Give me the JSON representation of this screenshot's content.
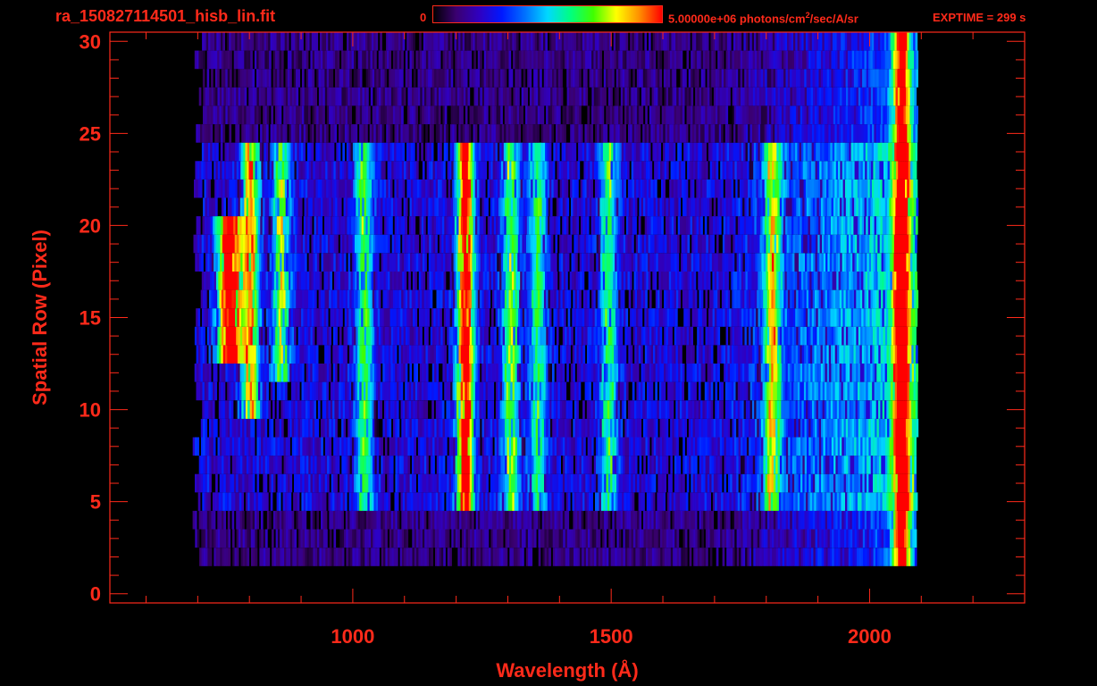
{
  "header": {
    "file_name": "ra_150827114501_hisb_lin.fit",
    "colorbar_min": "0",
    "colorbar_max_prefix": "5.00000e+06 photons/cm",
    "colorbar_max_exp": "2",
    "colorbar_max_suffix": "/sec/A/sr",
    "exptime": "EXPTIME = 299 s"
  },
  "colors": {
    "axis": "#ff2a1a",
    "background": "#000000",
    "colormap": [
      "#000000",
      "#3a0070",
      "#3000c0",
      "#0018ff",
      "#0070ff",
      "#00d8ff",
      "#00ff80",
      "#40ff00",
      "#ffff00",
      "#ff9000",
      "#ff0000"
    ]
  },
  "chart_data": {
    "type": "heatmap",
    "title": "",
    "xlabel": "Wavelength (Å)",
    "ylabel": "Spatial Row (Pixel)",
    "xlim": [
      530,
      2300
    ],
    "ylim": [
      -0.5,
      30.5
    ],
    "xticks": [
      1000,
      1500,
      2000
    ],
    "yticks": [
      0,
      5,
      10,
      15,
      20,
      25,
      30
    ],
    "x_minor_step": 100,
    "y_minor_step": 1,
    "value_range": [
      0,
      5000000
    ],
    "value_units": "photons/cm^2/sec/A/sr",
    "data_extent": {
      "wavelength": [
        700,
        2090
      ],
      "rows": [
        2,
        30
      ],
      "bright_slit_rows": [
        5,
        24
      ]
    },
    "features": [
      {
        "wavelength": 760,
        "rows": [
          13,
          20
        ],
        "peak": 1.0
      },
      {
        "wavelength": 800,
        "rows": [
          10,
          24
        ],
        "peak": 0.7
      },
      {
        "wavelength": 860,
        "rows": [
          12,
          24
        ],
        "peak": 0.55
      },
      {
        "wavelength": 1020,
        "rows": [
          5,
          24
        ],
        "peak": 0.45
      },
      {
        "wavelength": 1216,
        "rows": [
          5,
          24
        ],
        "peak": 0.95
      },
      {
        "wavelength": 1304,
        "rows": [
          5,
          24
        ],
        "peak": 0.5
      },
      {
        "wavelength": 1356,
        "rows": [
          5,
          24
        ],
        "peak": 0.4
      },
      {
        "wavelength": 1493,
        "rows": [
          5,
          24
        ],
        "peak": 0.42
      },
      {
        "wavelength": 1810,
        "rows": [
          5,
          24
        ],
        "peak": 0.55
      },
      {
        "wavelength": 2060,
        "rows": [
          2,
          30
        ],
        "peak": 0.85
      }
    ]
  }
}
